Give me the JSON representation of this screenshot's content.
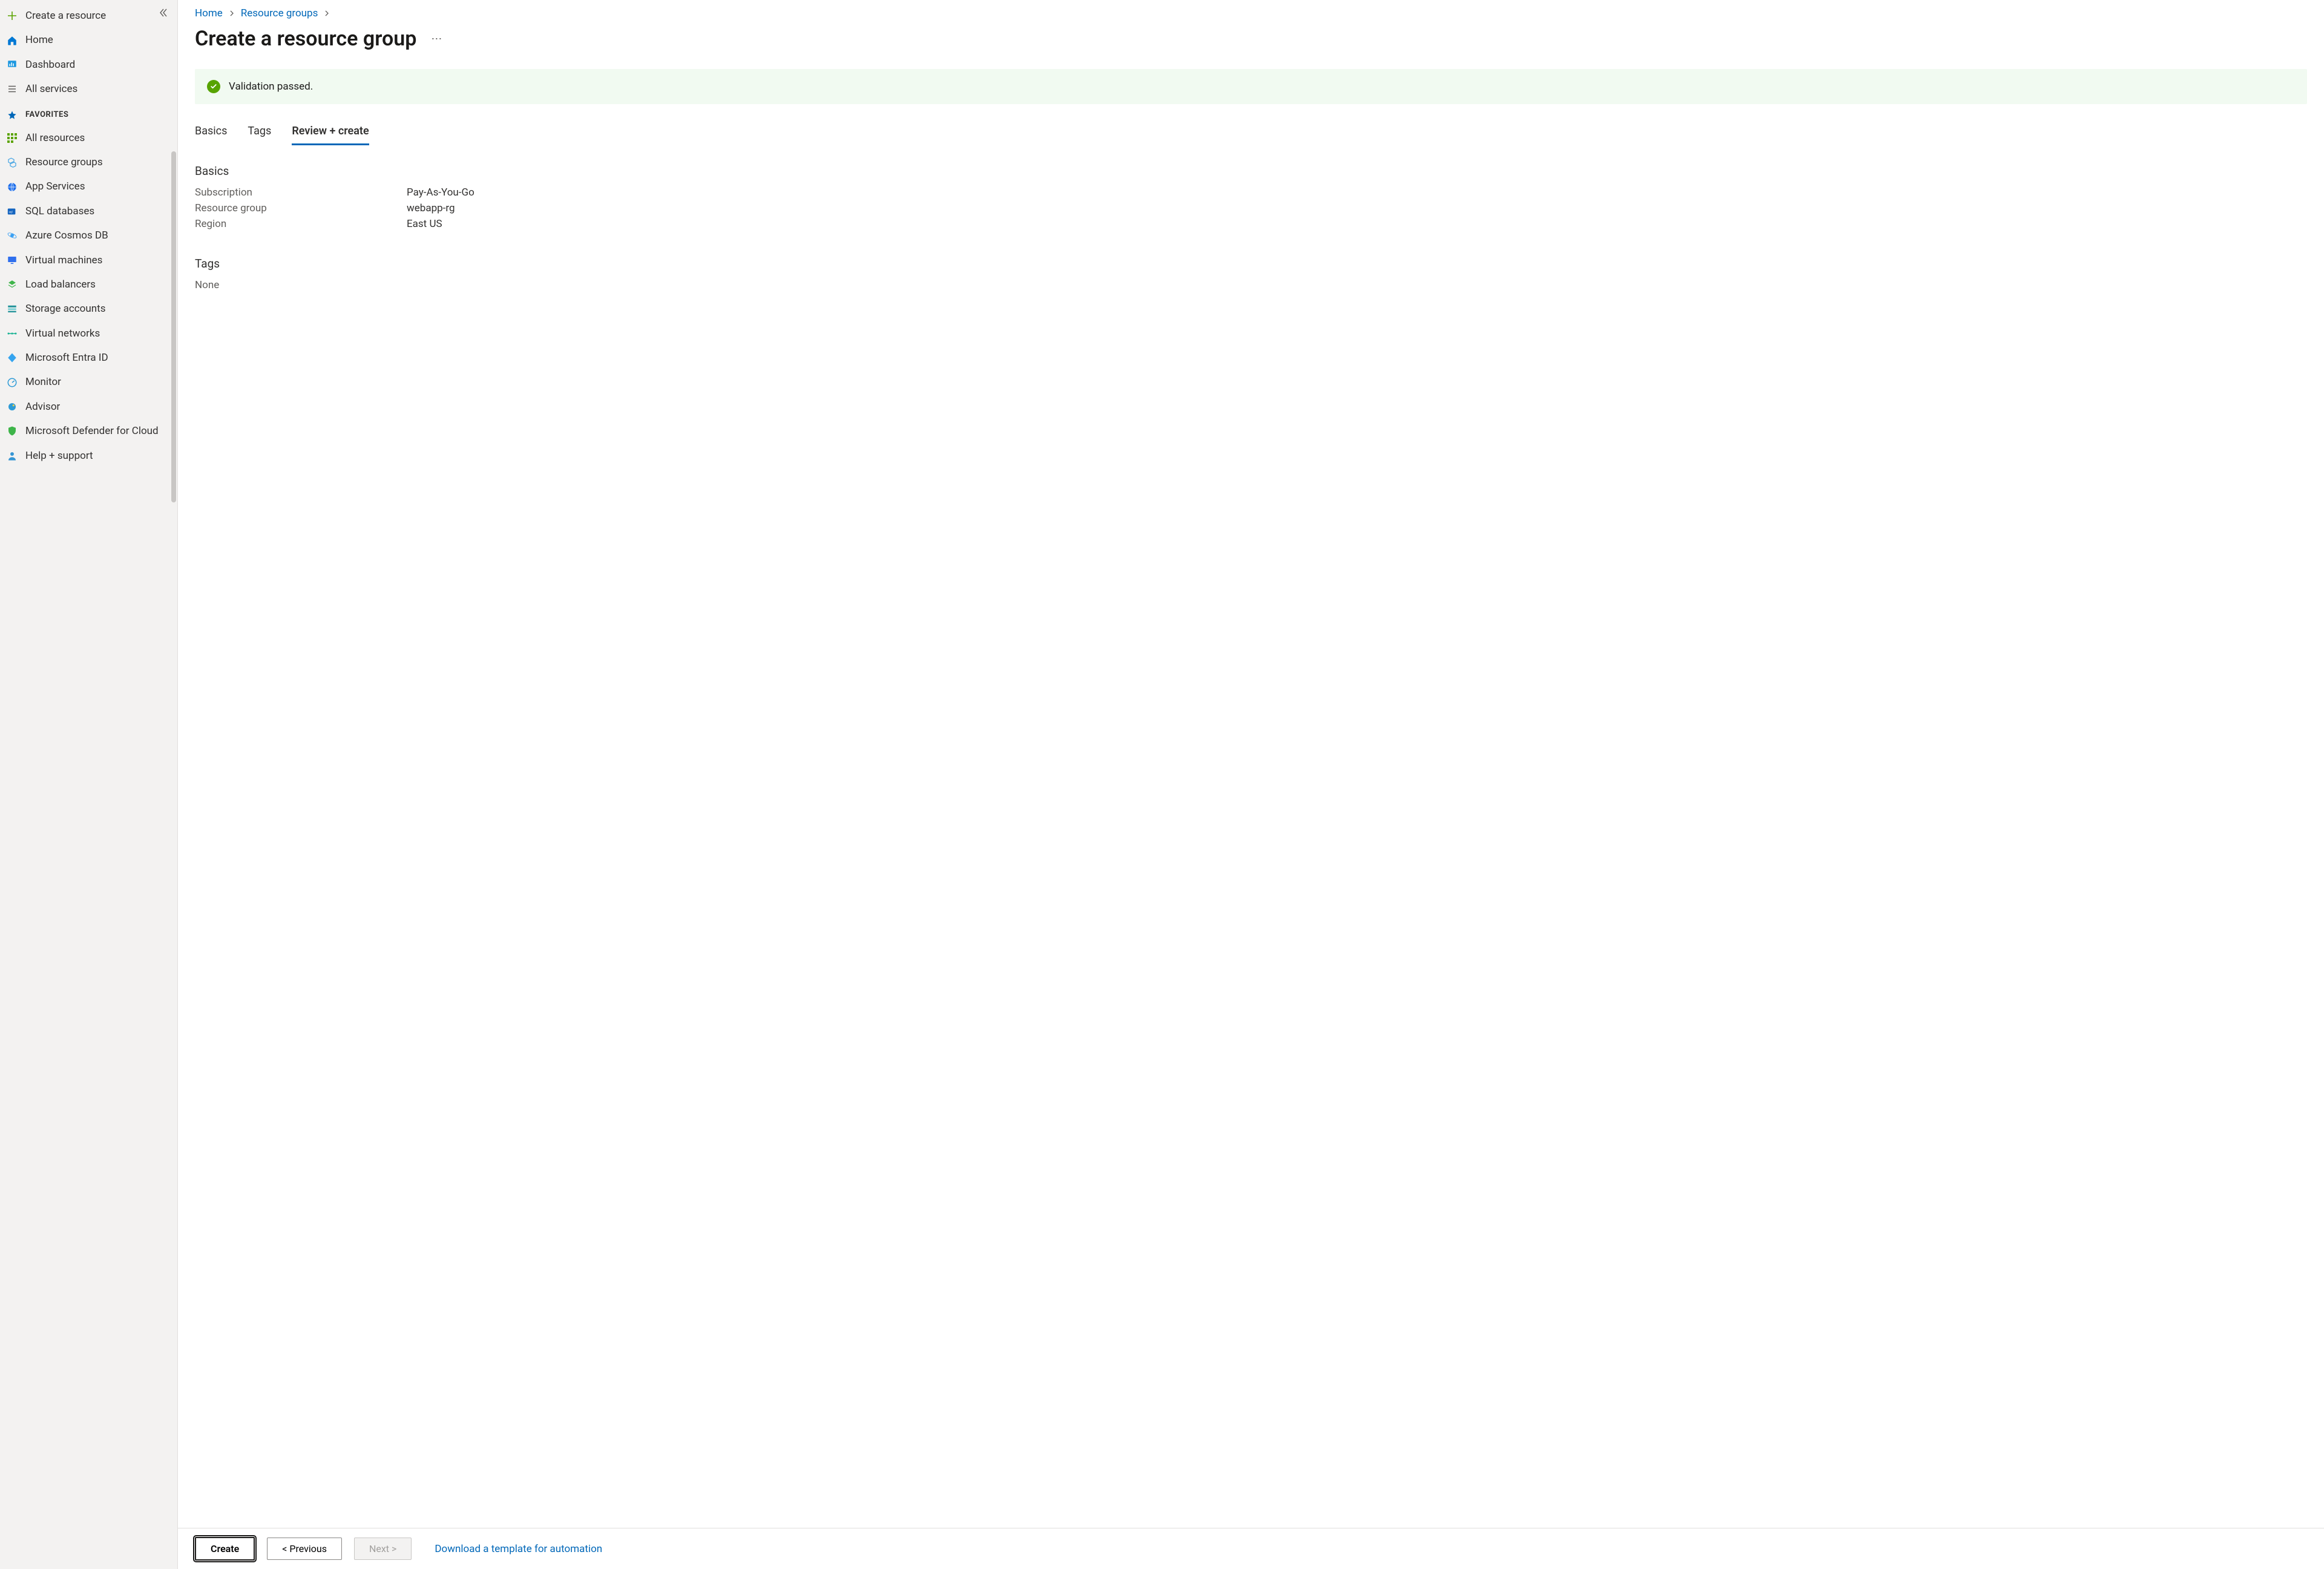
{
  "sidebar": {
    "collapse_aria": "Collapse navigation",
    "top_items": [
      {
        "id": "create-resource",
        "label": "Create a resource",
        "icon": "plus"
      },
      {
        "id": "home",
        "label": "Home",
        "icon": "home"
      },
      {
        "id": "dashboard",
        "label": "Dashboard",
        "icon": "dashboard"
      },
      {
        "id": "all-services",
        "label": "All services",
        "icon": "list"
      }
    ],
    "favorites_label": "FAVORITES",
    "fav_items": [
      {
        "id": "all-resources",
        "label": "All resources",
        "icon": "grid",
        "color": "#5BA300"
      },
      {
        "id": "resource-groups",
        "label": "Resource groups",
        "icon": "cube-group",
        "color": "#40A2E3"
      },
      {
        "id": "app-services",
        "label": "App Services",
        "icon": "globe",
        "color": "#1F6FEB"
      },
      {
        "id": "sql-databases",
        "label": "SQL databases",
        "icon": "sql",
        "color": "#1565C0"
      },
      {
        "id": "cosmos-db",
        "label": "Azure Cosmos DB",
        "icon": "cosmos",
        "color": "#3AA0F3"
      },
      {
        "id": "virtual-machines",
        "label": "Virtual machines",
        "icon": "vm",
        "color": "#2F6FED"
      },
      {
        "id": "load-balancers",
        "label": "Load balancers",
        "icon": "lb",
        "color": "#3EB54A"
      },
      {
        "id": "storage-accounts",
        "label": "Storage accounts",
        "icon": "storage",
        "color": "#219299"
      },
      {
        "id": "virtual-networks",
        "label": "Virtual networks",
        "icon": "vnet",
        "color": "#1AB394"
      },
      {
        "id": "entra-id",
        "label": "Microsoft Entra ID",
        "icon": "entra",
        "color": "#35A4EF"
      },
      {
        "id": "monitor",
        "label": "Monitor",
        "icon": "monitor",
        "color": "#2E9BD6"
      },
      {
        "id": "advisor",
        "label": "Advisor",
        "icon": "advisor",
        "color": "#2E9BD6"
      },
      {
        "id": "defender",
        "label": "Microsoft Defender for Cloud",
        "icon": "shield",
        "color": "#3EB54A"
      },
      {
        "id": "help-support",
        "label": "Help + support",
        "icon": "support",
        "color": "#3696D4"
      }
    ]
  },
  "breadcrumb": [
    {
      "label": "Home"
    },
    {
      "label": "Resource groups"
    }
  ],
  "page_title": "Create a resource group",
  "more_actions_aria": "More actions",
  "banner": {
    "message": "Validation passed."
  },
  "tabs": [
    {
      "id": "basics",
      "label": "Basics",
      "active": false
    },
    {
      "id": "tags",
      "label": "Tags",
      "active": false
    },
    {
      "id": "review-create",
      "label": "Review + create",
      "active": true
    }
  ],
  "review": {
    "basics_title": "Basics",
    "basics": [
      {
        "k": "Subscription",
        "v": "Pay-As-You-Go"
      },
      {
        "k": "Resource group",
        "v": "webapp-rg"
      },
      {
        "k": "Region",
        "v": "East US"
      }
    ],
    "tags_title": "Tags",
    "tags_none": "None"
  },
  "footer": {
    "create": "Create",
    "previous": "< Previous",
    "next": "Next >",
    "download_link": "Download a template for automation"
  }
}
